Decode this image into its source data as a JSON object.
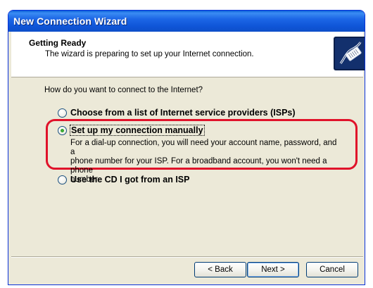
{
  "window": {
    "title": "New Connection Wizard"
  },
  "header": {
    "title": "Getting Ready",
    "subtitle": "The wizard is preparing to set up your Internet connection.",
    "icon": "network-cable-icon"
  },
  "main": {
    "question": "How do you want to connect to the Internet?",
    "options": [
      {
        "label": "Choose from a list of Internet service providers (ISPs)",
        "selected": false
      },
      {
        "label": "Set up my connection manually",
        "selected": true
      },
      {
        "label": "Use the CD I got from an ISP",
        "selected": false
      }
    ],
    "manual_description_lines": [
      "For a dial-up connection, you will need your account name, password, and a",
      "phone number for your ISP. For a broadband account, you won't need a phone",
      "number."
    ],
    "highlight_color": "#e0122a"
  },
  "footer": {
    "back_label": "< Back",
    "next_label": "Next >",
    "cancel_label": "Cancel"
  }
}
